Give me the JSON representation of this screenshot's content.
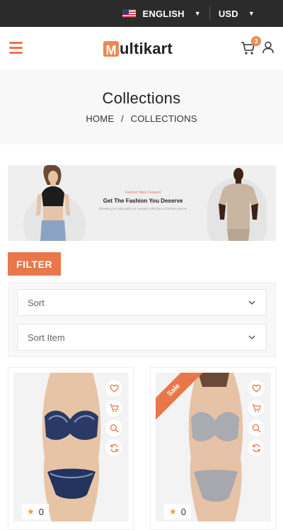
{
  "topbar": {
    "language": "ENGLISH",
    "currency": "USD"
  },
  "header": {
    "logo_mark": "M",
    "logo_text": "ultikart",
    "cart_count": "3"
  },
  "breadcrumb": {
    "title": "Collections",
    "home": "HOME",
    "separator": "/",
    "current": "COLLECTIONS"
  },
  "promo": {
    "kicker": "Fashion Style Forward",
    "headline": "Get The Fashion You Deserve",
    "subtext": "Elevate your style with our curated collection of fashion pieces"
  },
  "filter": {
    "button_label": "FILTER",
    "sort_label": "Sort",
    "sort_item_label": "Sort Item"
  },
  "products": [
    {
      "rating": "0",
      "sale": false
    },
    {
      "rating": "0",
      "sale": true,
      "sale_label": "Sale"
    }
  ],
  "colors": {
    "accent": "#e8784a",
    "topbar": "#2b2b2b",
    "text": "#222222"
  },
  "icons": [
    "menu-icon",
    "cart-icon",
    "user-icon",
    "chevron-down-icon",
    "heart-icon",
    "search-icon",
    "refresh-icon",
    "star-icon"
  ]
}
